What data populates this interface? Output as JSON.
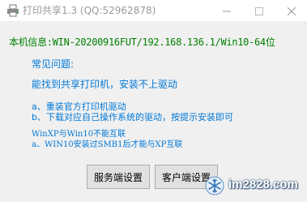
{
  "window": {
    "title": "打印共享1.3  (QQ:52962878)",
    "icons": {
      "app": "printer-icon",
      "minimize": "minimize-icon",
      "maximize": "maximize-icon",
      "close": "close-icon"
    }
  },
  "info": {
    "text": "本机信息:WIN-20200916FUT/192.168.136.1/Win10-64位"
  },
  "faq": {
    "heading": "常见问题:",
    "question": "能找到共享打印机，安装不上驱动",
    "answer_a": "a、重装官方打印机驱动",
    "answer_b": "b、下载对应自己操作系统的驱动，按提示安装即可",
    "note": "WinXP与Win10不能互联",
    "note_a": "a、WIN10安装过SMB1后才能与XP互联"
  },
  "buttons": {
    "server_settings": "服务端设置",
    "client_settings": "客户端设置"
  },
  "watermark": {
    "text": "im2828.com",
    "icon": "snowflake-logo-icon"
  },
  "colors": {
    "info_text": "#008000",
    "faq_text": "#0078d7",
    "window_bg": "#f0f0f0",
    "titlebar_bg": "#ffffff",
    "title_text": "#9a9a9a"
  }
}
